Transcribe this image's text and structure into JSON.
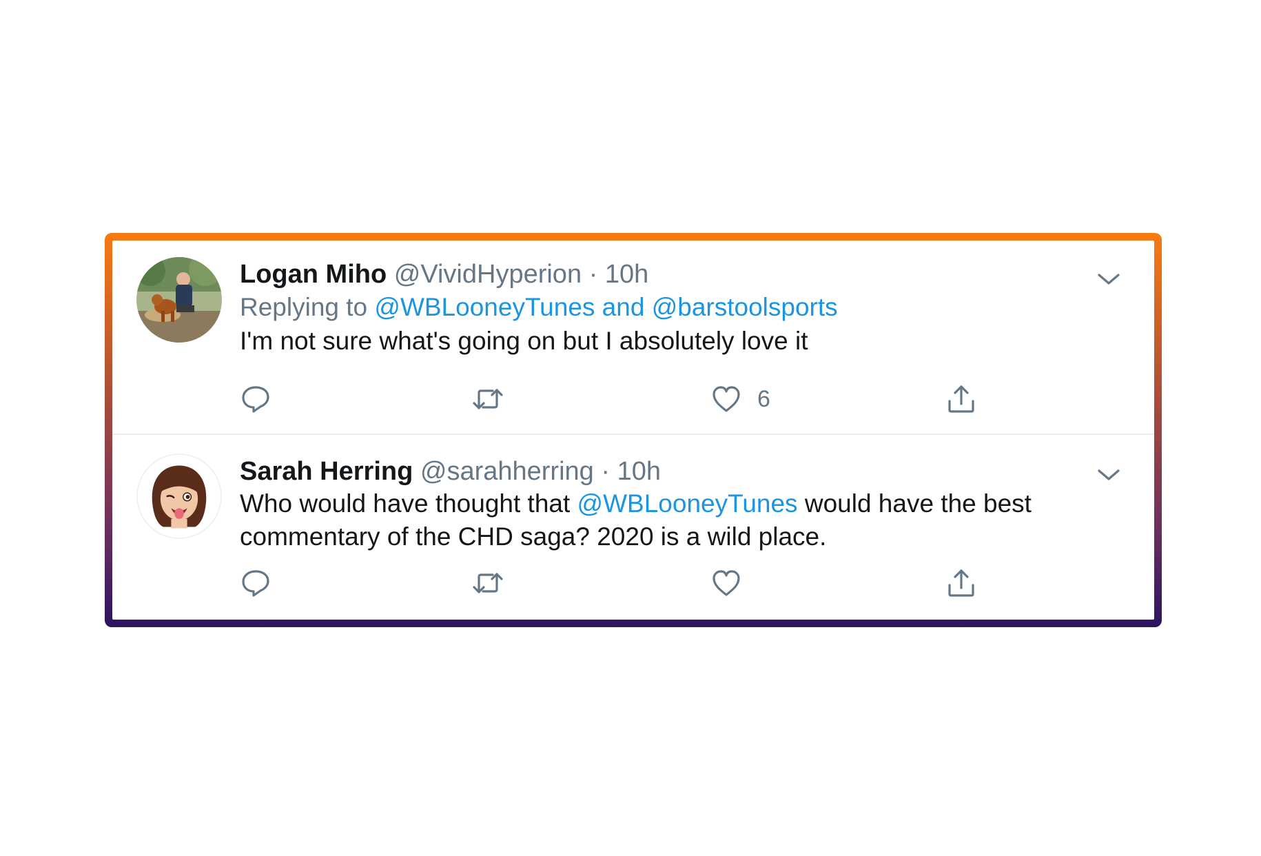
{
  "tweets": [
    {
      "name": "Logan Miho",
      "handle": "@VividHyperion",
      "separator": " · ",
      "time": "10h",
      "replying_prefix": "Replying to ",
      "replying_targets": "@WBLooneyTunes and @barstoolsports",
      "text": "I'm not sure what's going on but I absolutely love it",
      "like_count": "6"
    },
    {
      "name": "Sarah Herring",
      "handle": "@sarahherring",
      "separator": " · ",
      "time": "10h",
      "text_before_mention": "Who would have thought that ",
      "mention": "@WBLooneyTunes",
      "text_after_mention": " would have the best commentary of the CHD saga? 2020 is a wild place."
    }
  ],
  "colors": {
    "link": "#1b95e0",
    "name": "#14171a",
    "muted": "#657786",
    "frame_top": "#f97a10",
    "frame_bottom": "#2c1460"
  },
  "icons": [
    "reply-icon",
    "retweet-icon",
    "like-icon",
    "share-icon",
    "chevron-down-icon"
  ]
}
